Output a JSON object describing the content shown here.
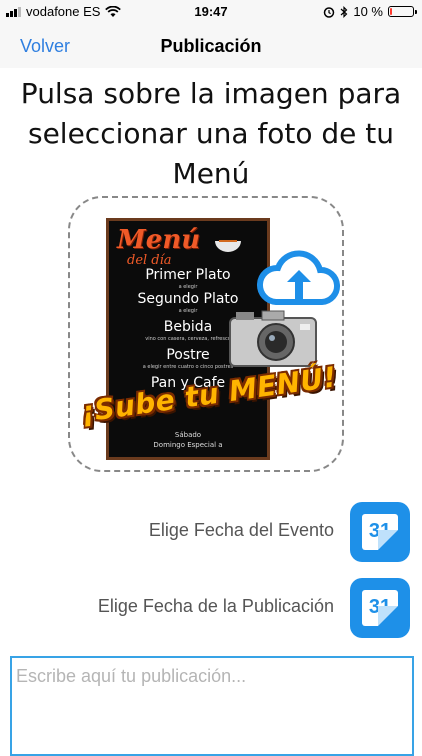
{
  "status_bar": {
    "carrier": "vodafone ES",
    "time": "19:47",
    "battery_text": "10 %",
    "battery_level": 0.1,
    "icons": [
      "signal-icon",
      "wifi-icon",
      "alarm-icon",
      "bluetooth-icon",
      "battery-icon"
    ]
  },
  "nav": {
    "back_label": "Volver",
    "title": "Publicación"
  },
  "instruction": "Pulsa sobre la imagen para seleccionar una foto de tu Menú",
  "upload_image": {
    "menu_title": "Menú",
    "menu_subtitle": "del día",
    "items": [
      {
        "label": "Primer Plato",
        "note": "a elegir"
      },
      {
        "label": "Segundo Plato",
        "note": "a elegir"
      },
      {
        "label": "Bebida",
        "note": "vino con casera, cerveza, refresco"
      },
      {
        "label": "Postre",
        "note": "a elegir entre cuatro o cinco postres"
      },
      {
        "label": "Pan y Cafe",
        "note": ""
      }
    ],
    "footer_days": "Sábado",
    "footer_special": "Domingo Especial a",
    "sticker_text": "¡Sube tu MENÚ!",
    "icons": [
      "cloud-upload-icon",
      "camera-icon"
    ]
  },
  "dates": {
    "event_label": "Elige Fecha del Evento",
    "publication_label": "Elige Fecha de la Publicación",
    "calendar_day": "31"
  },
  "post": {
    "placeholder": "Escribe aquí tu publicación...",
    "value": ""
  },
  "colors": {
    "accent": "#2f7fe0",
    "calendar_blue": "#1e90e8",
    "input_border": "#38a3e6",
    "battery_low": "#ff3b30"
  }
}
